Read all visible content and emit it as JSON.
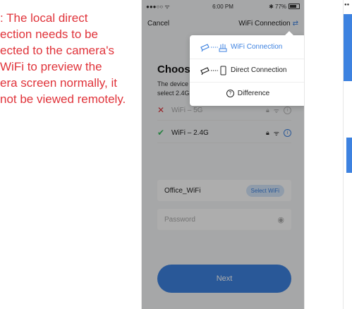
{
  "note": {
    "lines": [
      ": The local direct",
      "ection needs to be",
      "ected to the camera's",
      "WiFi to preview the",
      "era screen normally, it",
      "not be viewed remotely."
    ]
  },
  "status_bar": {
    "signal": "●●●○○ ",
    "time": "6:00 PM",
    "battery": "✱ 77%"
  },
  "nav": {
    "cancel": "Cancel",
    "mode": "WiFi Connection"
  },
  "page": {
    "heading": "Choose",
    "desc_line1": "The device",
    "desc_line2": "select 2.4G"
  },
  "networks": {
    "wifi5": {
      "label": "WiFi – 5G"
    },
    "wifi24": {
      "label": "WiFi – 2.4G"
    }
  },
  "form": {
    "ssid": "Office_WiFi",
    "select_wifi": "Select WiFi",
    "password_placeholder": "Password"
  },
  "next_button": "Next",
  "popup": {
    "option1": "WiFi Connection",
    "option2": "Direct Connection",
    "difference": "Difference"
  },
  "colors": {
    "accent": "#3d82e0",
    "note": "#e0333a",
    "success": "#3bbf62"
  }
}
